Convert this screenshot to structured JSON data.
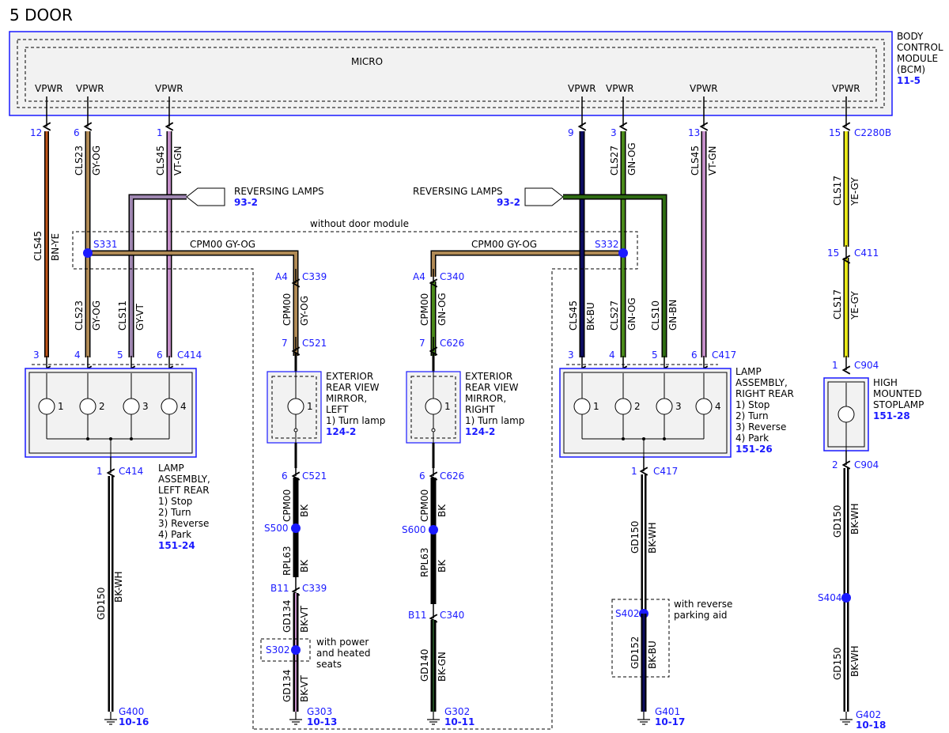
{
  "title": "5 DOOR",
  "bcm": {
    "label_lines": [
      "BODY",
      "CONTROL",
      "MODULE",
      "(BCM)"
    ],
    "ref": "11-5",
    "inner_label": "MICRO",
    "pin_label": "VPWR"
  },
  "wires": {
    "w1": {
      "pin": "12",
      "circuit": "CLS45",
      "color": "BN-YE"
    },
    "w2": {
      "pin": "6",
      "circuit": "CLS23",
      "color": "GY-OG"
    },
    "w3": {
      "pin": "1",
      "circuit": "CLS45",
      "color": "VT-GN"
    },
    "w4": {
      "pin": "9"
    },
    "w5": {
      "pin": "3",
      "circuit": "CLS27",
      "color": "GN-OG"
    },
    "w6": {
      "pin": "13",
      "circuit": "CLS45",
      "color": "VT-GN"
    },
    "w7": {
      "pin": "15",
      "connector": "C2280B",
      "circuit": "CLS17",
      "color": "YE-GY"
    }
  },
  "reversing_left": {
    "label": "REVERSING LAMPS",
    "ref": "93-2"
  },
  "reversing_right": {
    "label": "REVERSING LAMPS",
    "ref": "93-2"
  },
  "without_door_module": "without door module",
  "splices": {
    "s331": "S331",
    "s332": "S332",
    "s500": "S500",
    "s600": "S600",
    "s302": "S302",
    "s402": "S402",
    "s404": "S404"
  },
  "cpm_left": "CPM00  GY-OG",
  "cpm_right": "CPM00  GY-OG",
  "left_lamp": {
    "pins_top": [
      "3",
      "4",
      "5",
      "6"
    ],
    "connector_top": "C414",
    "wire_labels": [
      {
        "circuit": "CLS23",
        "color": "GY-OG"
      },
      {
        "circuit": "CLS11",
        "color": "GY-VT"
      }
    ],
    "bulbs": [
      "1",
      "2",
      "3",
      "4"
    ],
    "pin_bottom": "1",
    "connector_bottom": "C414",
    "name_lines": [
      "LAMP",
      "ASSEMBLY,",
      "LEFT REAR",
      "1) Stop",
      "2) Turn",
      "3) Reverse",
      "4) Park"
    ],
    "ref": "151-24",
    "ground_wire": {
      "circuit": "GD150",
      "color": "BK-WH"
    },
    "ground": "G400",
    "ground_ref": "10-16"
  },
  "right_lamp": {
    "pins_top": [
      "3",
      "4",
      "5",
      "6"
    ],
    "connector_top": "C417",
    "wire_labels": [
      {
        "circuit": "CLS45",
        "color": "BK-BU"
      },
      {
        "circuit": "CLS27",
        "color": "GN-OG"
      },
      {
        "circuit": "CLS10",
        "color": "GN-BN"
      }
    ],
    "bulbs": [
      "1",
      "2",
      "3",
      "4"
    ],
    "pin_bottom": "1",
    "connector_bottom": "C417",
    "name_lines": [
      "LAMP",
      "ASSEMBLY,",
      "RIGHT REAR",
      "1) Stop",
      "2) Turn",
      "3) Reverse",
      "4) Park"
    ],
    "ref": "151-26",
    "ground_wire_1": {
      "circuit": "GD150",
      "color": "BK-WH"
    },
    "option": [
      "with reverse",
      "parking aid"
    ],
    "ground_wire_2": {
      "circuit": "GD152",
      "color": "BK-BU"
    },
    "ground": "G401",
    "ground_ref": "10-17"
  },
  "mirror_left": {
    "c339_pin": "A4",
    "c339": "C339",
    "wire1": {
      "circuit": "CPM00",
      "color": "GY-OG"
    },
    "c521_pin": "7",
    "c521": "C521",
    "name_lines": [
      "EXTERIOR",
      "REAR VIEW",
      "MIRROR,",
      "LEFT",
      "1) Turn lamp"
    ],
    "bulb": "1",
    "ref": "124-2",
    "c521b_pin": "6",
    "c521b": "C521",
    "wire2": {
      "circuit": "CPM00",
      "color": "BK"
    },
    "wire3": {
      "circuit": "RPL63",
      "color": "BK"
    },
    "c339b_pin": "B11",
    "c339b": "C339",
    "wire4": {
      "circuit": "GD134",
      "color": "BK-VT"
    },
    "option": [
      "with power",
      "and heated",
      "seats"
    ],
    "wire5": {
      "circuit": "GD134",
      "color": "BK-VT"
    },
    "ground": "G303",
    "ground_ref": "10-13"
  },
  "mirror_right": {
    "c340_pin": "A4",
    "c340": "C340",
    "wire1": {
      "circuit": "CPM00",
      "color": "GN-OG"
    },
    "c626_pin": "7",
    "c626": "C626",
    "name_lines": [
      "EXTERIOR",
      "REAR VIEW",
      "MIRROR,",
      "RIGHT",
      "1) Turn lamp"
    ],
    "bulb": "1",
    "ref": "124-2",
    "c626b_pin": "6",
    "c626b": "C626",
    "wire2": {
      "circuit": "CPM00",
      "color": "BK"
    },
    "wire3": {
      "circuit": "RPL63",
      "color": "BK"
    },
    "c340b_pin": "B11",
    "c340b": "C340",
    "wire4": {
      "circuit": "GD140",
      "color": "BK-GN"
    },
    "ground": "G302",
    "ground_ref": "10-11"
  },
  "right_wire4": {
    "circuit": "CLS45",
    "color": "BK-BU"
  },
  "hmsl": {
    "c411_pin": "15",
    "c411": "C411",
    "wire2": {
      "circuit": "CLS17",
      "color": "YE-GY"
    },
    "c904_pin": "1",
    "c904": "C904",
    "name_lines": [
      "HIGH",
      "MOUNTED",
      "STOPLAMP"
    ],
    "ref": "151-28",
    "c904b_pin": "2",
    "c904b": "C904",
    "wire3": {
      "circuit": "GD150",
      "color": "BK-WH"
    },
    "wire4": {
      "circuit": "GD150",
      "color": "BK-WH"
    },
    "ground": "G402",
    "ground_ref": "10-18"
  },
  "colors": {
    "frame_blue": "#1a1aff",
    "gy_og": "#b08a55",
    "vt_gn": "#c48ec8",
    "gy_vt": "#9e86b0",
    "bn_ye": "#c0561a",
    "gn_og": "#4a8a1a",
    "gn_bn": "#2e6b12",
    "bk_bu": "#0c0c60",
    "ye_gy": "#e6e61a",
    "bk_gn": "#204a20",
    "bk_vt": "#5a2a5a"
  }
}
